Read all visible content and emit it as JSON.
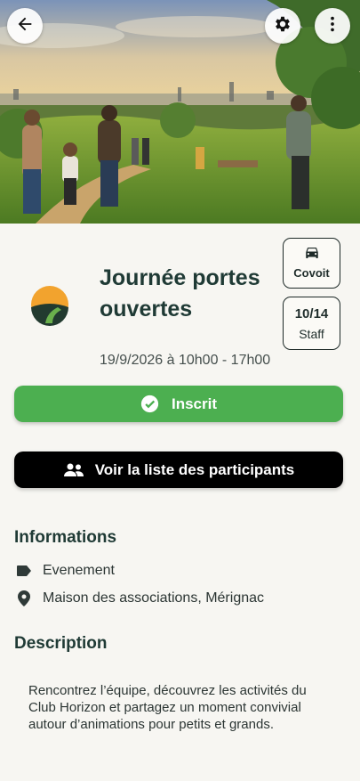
{
  "event": {
    "title": "Journée portes ouvertes",
    "date": "19/9/2026 à 10h00 - 17h00"
  },
  "header": {
    "icons": [
      "arrow-back-icon",
      "gear-icon",
      "more-vert-icon"
    ]
  },
  "chips": {
    "covoit_label": "Covoit",
    "staff_count": "10/14",
    "staff_label": "Staff"
  },
  "actions": {
    "inscrit_label": "Inscrit",
    "participants_label": "Voir la liste des participants"
  },
  "info": {
    "title": "Informations",
    "type": "Evenement",
    "location": "Maison des associations, Mérignac"
  },
  "description": {
    "title": "Description",
    "text": "Rencontrez l’équipe, découvrez les activités du Club Horizon et partagez un moment convivial autour d’animations pour petits et grands."
  },
  "colors": {
    "accent_green": "#4caf50",
    "title_text": "#1f3a35",
    "black_button": "#000000"
  }
}
